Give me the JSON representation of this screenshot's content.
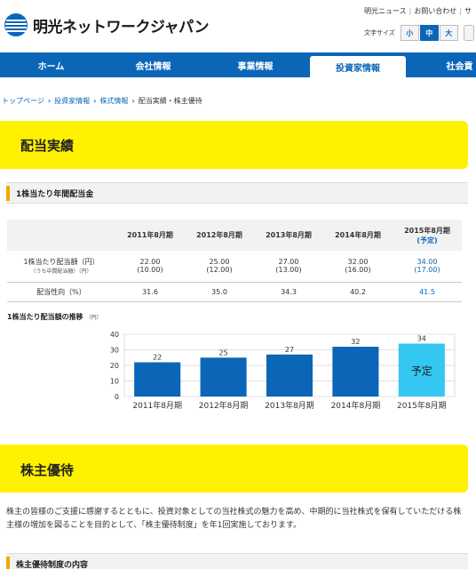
{
  "header": {
    "logo_text": "明光ネットワークジャパン",
    "util_links": [
      "明光ニュース",
      "お問い合わせ",
      "サ"
    ],
    "fontsize_label": "文字サイズ",
    "fontsize_options": [
      "小",
      "中",
      "大"
    ],
    "fontsize_selected": "中"
  },
  "nav": {
    "items": [
      "ホーム",
      "会社情報",
      "事業情報",
      "投資家情報",
      "社会貢"
    ],
    "active": "投資家情報"
  },
  "breadcrumb": {
    "links": [
      "トップページ",
      "投資家情報",
      "株式情報"
    ],
    "current": "配当実績・株主優待"
  },
  "section1": {
    "title": "配当実績",
    "subheading": "1株当たり年間配当金"
  },
  "table": {
    "columns": [
      "2011年8月期",
      "2012年8月期",
      "2013年8月期",
      "2014年8月期",
      "2015年8月期"
    ],
    "forecast_note": "(予定)",
    "row1_label": "1株当たり配当額（円）",
    "row1_sublabel": "（うち中間配当額）（円）",
    "row1_values": [
      "22.00",
      "25.00",
      "27.00",
      "32.00",
      "34.00"
    ],
    "row1_interim": [
      "(10.00)",
      "(12.00)",
      "(13.00)",
      "(16.00)",
      "(17.00)"
    ],
    "row2_label": "配当性向（%）",
    "row2_values": [
      "31.6",
      "35.0",
      "34.3",
      "40.2",
      "41.5"
    ]
  },
  "chart_title": "1株当たり配当額の推移",
  "chart_unit": "（円）",
  "chart_data": {
    "type": "bar",
    "categories": [
      "2011年8月期",
      "2012年8月期",
      "2013年8月期",
      "2014年8月期",
      "2015年8月期"
    ],
    "values": [
      22,
      25,
      27,
      32,
      34
    ],
    "data_labels": [
      "22",
      "25",
      "27",
      "32",
      "34"
    ],
    "forecast_label": "予定",
    "ylim": [
      0,
      40
    ],
    "yticks": [
      0,
      10,
      20,
      30,
      40
    ],
    "colors": {
      "actual": "#0b66b8",
      "forecast": "#33c7f2"
    },
    "grid": true
  },
  "section2": {
    "title": "株主優待",
    "paragraph": "株主の皆様のご支援に感謝するとともに、投資対象としての当社株式の魅力を高め、中期的に当社株式を保有していただける株主様の増加を図ることを目的として、「株主優待制度」を年1回実施しております。",
    "subheading": "株主優待制度の内容"
  },
  "colors": {
    "brand_blue": "#0b66b8",
    "highlight_yellow": "#fff200",
    "accent_orange": "#f5a800"
  }
}
